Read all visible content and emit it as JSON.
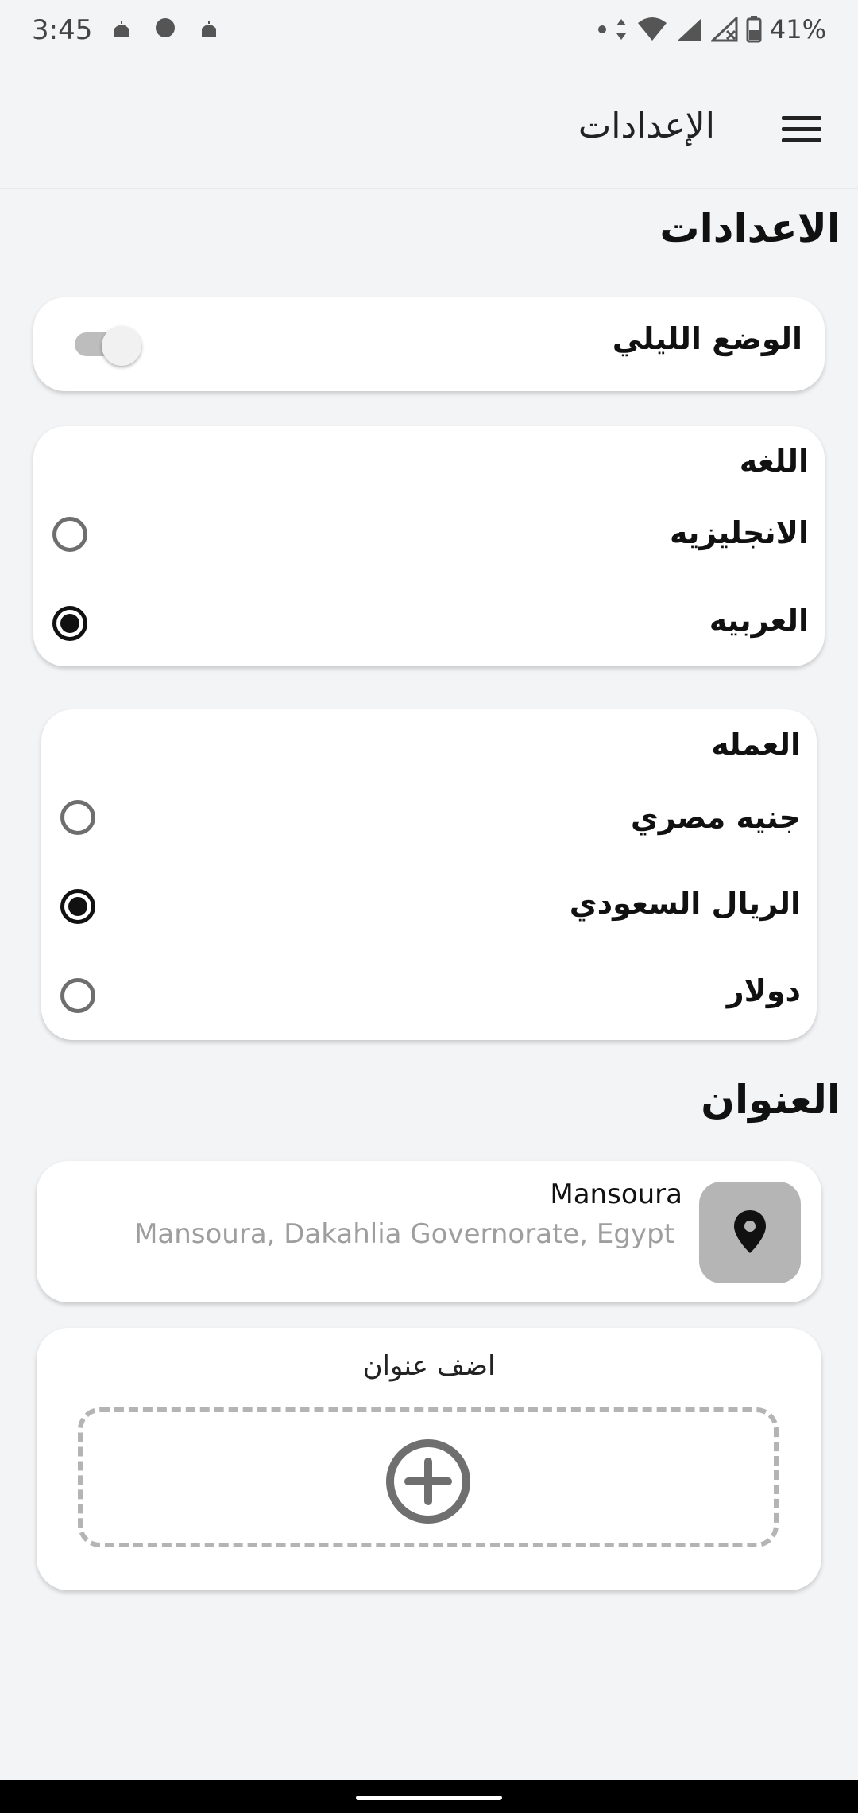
{
  "status": {
    "time": "3:45",
    "battery": "41%",
    "left_icons": [
      "mosque-notification-icon",
      "circle-notification-icon",
      "mosque-notification-icon"
    ],
    "right_icons": [
      "dot-icon",
      "data-arrows-icon",
      "wifi-icon",
      "signal-icon",
      "signal-no-service-icon",
      "battery-icon"
    ]
  },
  "appbar": {
    "title": "الإعدادات",
    "menu_icon": "hamburger-menu-icon"
  },
  "page": {
    "heading": "الاعدادات"
  },
  "night_mode": {
    "label": "الوضع الليلي",
    "enabled": false
  },
  "language": {
    "title": "اللغه",
    "options": [
      {
        "label": "الانجليزيه",
        "selected": false
      },
      {
        "label": "العربيه",
        "selected": true
      }
    ]
  },
  "currency": {
    "title": "العمله",
    "options": [
      {
        "label": "جنيه مصري",
        "selected": false
      },
      {
        "label": "الريال السعودي",
        "selected": true
      },
      {
        "label": "دولار",
        "selected": false
      }
    ]
  },
  "address_section": {
    "heading": "العنوان",
    "address": {
      "name": "Mansoura",
      "full": "Mansoura, Dakahlia Governorate, Egypt",
      "icon": "location-pin-icon"
    },
    "add": {
      "label": "اضف عنوان",
      "icon": "add-circle-icon"
    }
  }
}
